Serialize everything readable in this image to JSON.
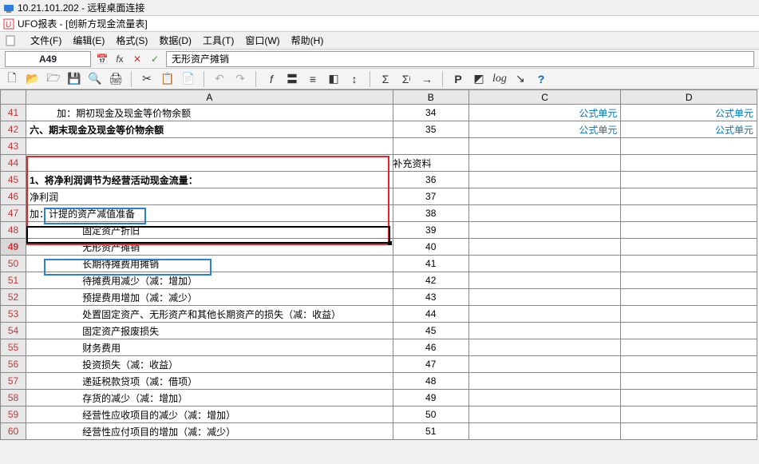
{
  "window": {
    "remote_title": "10.21.101.202 - 远程桌面连接",
    "app_title": "UFO报表 - [创新方现金流量表]"
  },
  "menu": {
    "file": "文件(F)",
    "edit": "编辑(E)",
    "format": "格式(S)",
    "data": "数据(D)",
    "tool": "工具(T)",
    "window": "窗口(W)",
    "help": "帮助(H)"
  },
  "cellbar": {
    "ref": "A49",
    "formula": "无形资产摊销"
  },
  "toolbar_icons": [
    "□",
    "▢",
    "▣",
    "💾",
    "🔍",
    "🖨",
    "✂",
    "📋",
    "📄",
    "↶",
    "↷",
    "f",
    "〓",
    "≡",
    "◧",
    "↕",
    "Σ",
    "Σᵢ",
    "→",
    "P",
    "◩",
    "log",
    "↘",
    "?"
  ],
  "columns": [
    "A",
    "B",
    "C",
    "D"
  ],
  "rows": [
    {
      "r": 41,
      "a": "加：期初现金及现金等价物余额",
      "a_cls": "indent1",
      "b": "34",
      "c": "公式单元",
      "d": "公式单元"
    },
    {
      "r": 42,
      "a": "六、期末现金及现金等价物余额",
      "a_cls": "bold",
      "b": "35",
      "c": "公式单元",
      "d": "公式单元"
    },
    {
      "r": 43,
      "a": "",
      "b": "",
      "c": "",
      "d": ""
    },
    {
      "r": 44,
      "a": "",
      "b": "补充资料",
      "c": "",
      "d": "",
      "b_center": true
    },
    {
      "r": 45,
      "a": "1、将净利润调节为经营活动现金流量：",
      "a_cls": "bold",
      "b": "36",
      "c": "",
      "d": ""
    },
    {
      "r": 46,
      "a": "净利润",
      "b": "37",
      "c": "",
      "d": ""
    },
    {
      "r": 47,
      "a": "加：计提的资产减值准备",
      "b": "38",
      "c": "",
      "d": ""
    },
    {
      "r": 48,
      "a": "固定资产折旧",
      "a_cls": "indent2",
      "b": "39",
      "c": "",
      "d": ""
    },
    {
      "r": 49,
      "a": "无形资产摊销",
      "a_cls": "indent2",
      "b": "40",
      "c": "",
      "d": ""
    },
    {
      "r": 50,
      "a": "长期待摊费用摊销",
      "a_cls": "indent2",
      "b": "41",
      "c": "",
      "d": ""
    },
    {
      "r": 51,
      "a": "待摊费用减少（减：增加）",
      "a_cls": "indent2",
      "b": "42",
      "c": "",
      "d": ""
    },
    {
      "r": 52,
      "a": "预提费用增加（减：减少）",
      "a_cls": "indent2",
      "b": "43",
      "c": "",
      "d": ""
    },
    {
      "r": 53,
      "a": "处置固定资产、无形资产和其他长期资产的损失（减：收益）",
      "a_cls": "indent2",
      "b": "44",
      "c": "",
      "d": ""
    },
    {
      "r": 54,
      "a": "固定资产报废损失",
      "a_cls": "indent2",
      "b": "45",
      "c": "",
      "d": ""
    },
    {
      "r": 55,
      "a": "财务费用",
      "a_cls": "indent2",
      "b": "46",
      "c": "",
      "d": ""
    },
    {
      "r": 56,
      "a": "投资损失（减：收益）",
      "a_cls": "indent2",
      "b": "47",
      "c": "",
      "d": ""
    },
    {
      "r": 57,
      "a": "递延税款贷项（减：借项）",
      "a_cls": "indent2",
      "b": "48",
      "c": "",
      "d": ""
    },
    {
      "r": 58,
      "a": "存货的减少（减：增加）",
      "a_cls": "indent2",
      "b": "49",
      "c": "",
      "d": ""
    },
    {
      "r": 59,
      "a": "经营性应收项目的减少（减：增加）",
      "a_cls": "indent2",
      "b": "50",
      "c": "",
      "d": ""
    },
    {
      "r": 60,
      "a": "经营性应付项目的增加（减：减少）",
      "a_cls": "indent2",
      "b": "51",
      "c": "",
      "d": ""
    }
  ],
  "selected_row": 49
}
